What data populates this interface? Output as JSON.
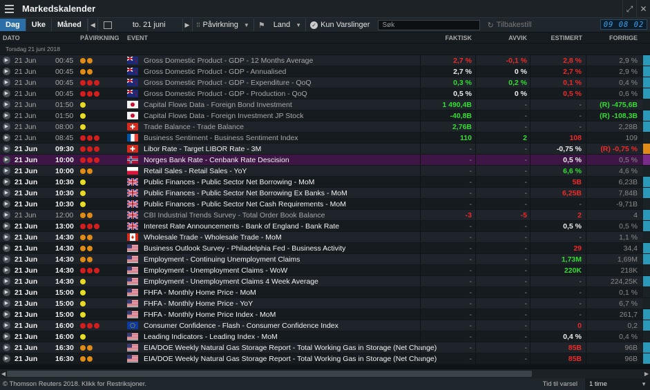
{
  "app": {
    "title": "Markedskalender",
    "clock": "09 08 02"
  },
  "toolbar": {
    "tabs": [
      "Dag",
      "Uke",
      "Måned"
    ],
    "date": "to. 21 juni",
    "impact_filter": "Påvirkning",
    "country_filter": "Land",
    "alerts_only": "Kun Varslinger",
    "search_placeholder": "Søk",
    "reset": "Tilbakestill"
  },
  "columns": {
    "date": "DATO",
    "impact": "PÅVIRKNING",
    "event": "EVENT",
    "actual": "FAKTISK",
    "deviation": "AVVIK",
    "estimate": "ESTIMERT",
    "previous": "FORRIGE"
  },
  "group_label": "Torsdag 21 juni 2018",
  "colors": {
    "accent": "#2c6fa8",
    "highlight": "#3e1646",
    "green": "#33dd33",
    "red": "#ee2a2a"
  },
  "rows": [
    {
      "date": "21 Jun",
      "time": "00:45",
      "impact": "oo",
      "flag": "nz",
      "event": "Gross Domestic Product - GDP - 12 Months Average",
      "actual": "2,7 %",
      "actual_c": "red",
      "dev": "-0,1 %",
      "dev_c": "red",
      "est": "2,8 %",
      "est_c": "red",
      "prev": "2,9 %",
      "prev_c": "gray",
      "past": true
    },
    {
      "date": "21 Jun",
      "time": "00:45",
      "impact": "oo",
      "flag": "nz",
      "event": "Gross Domestic Product - GDP - Annualised",
      "actual": "2,7 %",
      "actual_c": "white",
      "dev": "0 %",
      "dev_c": "white",
      "est": "2,7 %",
      "est_c": "red",
      "prev": "2,9 %",
      "prev_c": "gray",
      "past": true
    },
    {
      "date": "21 Jun",
      "time": "00:45",
      "impact": "rrr",
      "flag": "nz",
      "event": "Gross Domestic Product - GDP - Expenditure - QoQ",
      "actual": "0,3 %",
      "actual_c": "green",
      "dev": "0,2 %",
      "dev_c": "green",
      "est": "0,1 %",
      "est_c": "red",
      "prev": "0,4 %",
      "prev_c": "gray",
      "past": true
    },
    {
      "date": "21 Jun",
      "time": "00:45",
      "impact": "rrr",
      "flag": "nz",
      "event": "Gross Domestic Product - GDP - Production - QoQ",
      "actual": "0,5 %",
      "actual_c": "white",
      "dev": "0 %",
      "dev_c": "white",
      "est": "0,5 %",
      "est_c": "red",
      "prev": "0,6 %",
      "prev_c": "gray",
      "past": true
    },
    {
      "date": "21 Jun",
      "time": "01:50",
      "impact": "y",
      "flag": "jp",
      "event": "Capital Flows Data - Foreign Bond Investment",
      "actual": "1 490,4B",
      "actual_c": "green",
      "dev": "-",
      "dev_c": "gray",
      "est": "-",
      "est_c": "gray",
      "prev": "(R) -475,6B",
      "prev_c": "green",
      "past": true
    },
    {
      "date": "21 Jun",
      "time": "01:50",
      "impact": "y",
      "flag": "jp",
      "event": "Capital Flows Data - Foreign Investment JP Stock",
      "actual": "-40,8B",
      "actual_c": "green",
      "dev": "-",
      "dev_c": "gray",
      "est": "-",
      "est_c": "gray",
      "prev": "(R) -108,3B",
      "prev_c": "green",
      "past": true
    },
    {
      "date": "21 Jun",
      "time": "08:00",
      "impact": "y",
      "flag": "ch",
      "event": "Trade Balance - Trade Balance",
      "actual": "2,76B",
      "actual_c": "green",
      "dev": "-",
      "dev_c": "gray",
      "est": "-",
      "est_c": "gray",
      "prev": "2,28B",
      "prev_c": "gray",
      "past": true
    },
    {
      "date": "21 Jun",
      "time": "08:45",
      "impact": "rrr",
      "flag": "fr",
      "event": "Business Sentiment - Business Sentiment Index",
      "actual": "110",
      "actual_c": "green",
      "dev": "2",
      "dev_c": "green",
      "est": "108",
      "est_c": "red",
      "prev": "109",
      "prev_c": "gray",
      "past": true
    },
    {
      "date": "21 Jun",
      "time": "09:30",
      "impact": "rrr",
      "flag": "ch",
      "event": "Libor Rate - Target LIBOR Rate - 3M",
      "actual": "-",
      "actual_c": "gray",
      "dev": "-",
      "dev_c": "gray",
      "est": "-0,75 %",
      "est_c": "white",
      "prev": "(R) -0,75 %",
      "prev_c": "red",
      "past": false
    },
    {
      "date": "21 Jun",
      "time": "10:00",
      "impact": "rrr",
      "flag": "no",
      "event": "Norges Bank Rate - Cenbank Rate Descision",
      "actual": "-",
      "actual_c": "gray",
      "dev": "-",
      "dev_c": "gray",
      "est": "0,5 %",
      "est_c": "white",
      "prev": "0,5 %",
      "prev_c": "gray",
      "past": false,
      "highlight": true
    },
    {
      "date": "21 Jun",
      "time": "10:00",
      "impact": "oo",
      "flag": "pl",
      "event": "Retail Sales - Retail Sales - YoY",
      "actual": "-",
      "actual_c": "gray",
      "dev": "-",
      "dev_c": "gray",
      "est": "6,6 %",
      "est_c": "green",
      "prev": "4,6 %",
      "prev_c": "gray",
      "past": false
    },
    {
      "date": "21 Jun",
      "time": "10:30",
      "impact": "y",
      "flag": "gb",
      "event": "Public Finances - Public Sector Net Borrowing - MoM",
      "actual": "-",
      "actual_c": "gray",
      "dev": "-",
      "dev_c": "gray",
      "est": "5B",
      "est_c": "red",
      "prev": "6,23B",
      "prev_c": "gray",
      "past": false
    },
    {
      "date": "21 Jun",
      "time": "10:30",
      "impact": "y",
      "flag": "gb",
      "event": "Public Finances - Public Sector Net Borrowing Ex Banks - MoM",
      "actual": "-",
      "actual_c": "gray",
      "dev": "-",
      "dev_c": "gray",
      "est": "6,25B",
      "est_c": "red",
      "prev": "7,84B",
      "prev_c": "gray",
      "past": false
    },
    {
      "date": "21 Jun",
      "time": "10:30",
      "impact": "y",
      "flag": "gb",
      "event": "Public Finances - Public Sector Net Cash Requirements - MoM",
      "actual": "-",
      "actual_c": "gray",
      "dev": "-",
      "dev_c": "gray",
      "est": "-",
      "est_c": "gray",
      "prev": "-9,71B",
      "prev_c": "gray",
      "past": false
    },
    {
      "date": "21 Jun",
      "time": "12:00",
      "impact": "oo",
      "flag": "gb",
      "event": "CBI Industrial Trends Survey - Total Order Book Balance",
      "actual": "-3",
      "actual_c": "red",
      "dev": "-5",
      "dev_c": "red",
      "est": "2",
      "est_c": "red",
      "prev": "4",
      "prev_c": "gray",
      "past": true
    },
    {
      "date": "21 Jun",
      "time": "13:00",
      "impact": "rrr",
      "flag": "gb",
      "event": "Interest Rate Announcements - Bank of England - Bank Rate",
      "actual": "-",
      "actual_c": "gray",
      "dev": "-",
      "dev_c": "gray",
      "est": "0,5 %",
      "est_c": "white",
      "prev": "0,5 %",
      "prev_c": "gray",
      "past": false
    },
    {
      "date": "21 Jun",
      "time": "14:30",
      "impact": "oo",
      "flag": "ca",
      "event": "Wholesale Trade - Wholesale Trade - MoM",
      "actual": "-",
      "actual_c": "gray",
      "dev": "-",
      "dev_c": "gray",
      "est": "-",
      "est_c": "gray",
      "prev": "1,1 %",
      "prev_c": "gray",
      "past": false
    },
    {
      "date": "21 Jun",
      "time": "14:30",
      "impact": "oo",
      "flag": "us",
      "event": "Business Outlook Survey - Philadelphia Fed - Business Activity",
      "actual": "-",
      "actual_c": "gray",
      "dev": "-",
      "dev_c": "gray",
      "est": "29",
      "est_c": "red",
      "prev": "34,4",
      "prev_c": "gray",
      "past": false
    },
    {
      "date": "21 Jun",
      "time": "14:30",
      "impact": "oo",
      "flag": "us",
      "event": "Employment - Continuing Unemployment Claims",
      "actual": "-",
      "actual_c": "gray",
      "dev": "-",
      "dev_c": "gray",
      "est": "1,73M",
      "est_c": "green",
      "prev": "1,69M",
      "prev_c": "gray",
      "past": false
    },
    {
      "date": "21 Jun",
      "time": "14:30",
      "impact": "rrr",
      "flag": "us",
      "event": "Employment - Unemployment Claims - WoW",
      "actual": "-",
      "actual_c": "gray",
      "dev": "-",
      "dev_c": "gray",
      "est": "220K",
      "est_c": "green",
      "prev": "218K",
      "prev_c": "gray",
      "past": false
    },
    {
      "date": "21 Jun",
      "time": "14:30",
      "impact": "y",
      "flag": "us",
      "event": "Employment - Unemployment Claims 4 Week Average",
      "actual": "-",
      "actual_c": "gray",
      "dev": "-",
      "dev_c": "gray",
      "est": "-",
      "est_c": "gray",
      "prev": "224,25K",
      "prev_c": "gray",
      "past": false
    },
    {
      "date": "21 Jun",
      "time": "15:00",
      "impact": "y",
      "flag": "us",
      "event": "FHFA - Monthly Home Price - MoM",
      "actual": "-",
      "actual_c": "gray",
      "dev": "-",
      "dev_c": "gray",
      "est": "-",
      "est_c": "gray",
      "prev": "0,1 %",
      "prev_c": "gray",
      "past": false
    },
    {
      "date": "21 Jun",
      "time": "15:00",
      "impact": "y",
      "flag": "us",
      "event": "FHFA - Monthly Home Price - YoY",
      "actual": "-",
      "actual_c": "gray",
      "dev": "-",
      "dev_c": "gray",
      "est": "-",
      "est_c": "gray",
      "prev": "6,7 %",
      "prev_c": "gray",
      "past": false
    },
    {
      "date": "21 Jun",
      "time": "15:00",
      "impact": "y",
      "flag": "us",
      "event": "FHFA - Monthly Home Price Index - MoM",
      "actual": "-",
      "actual_c": "gray",
      "dev": "-",
      "dev_c": "gray",
      "est": "-",
      "est_c": "gray",
      "prev": "261,7",
      "prev_c": "gray",
      "past": false
    },
    {
      "date": "21 Jun",
      "time": "16:00",
      "impact": "rrr",
      "flag": "eu",
      "event": "Consumer Confidence - Flash - Consumer Confidence Index",
      "actual": "-",
      "actual_c": "gray",
      "dev": "-",
      "dev_c": "gray",
      "est": "0",
      "est_c": "red",
      "prev": "0,2",
      "prev_c": "gray",
      "past": false
    },
    {
      "date": "21 Jun",
      "time": "16:00",
      "impact": "y",
      "flag": "us",
      "event": "Leading Indicators - Leading Index - MoM",
      "actual": "-",
      "actual_c": "gray",
      "dev": "-",
      "dev_c": "gray",
      "est": "0,4 %",
      "est_c": "white",
      "prev": "0,4 %",
      "prev_c": "gray",
      "past": false
    },
    {
      "date": "21 Jun",
      "time": "16:30",
      "impact": "oo",
      "flag": "us",
      "event": "EIA/DOE Weekly Natural Gas Storage Report - Total Working Gas in Storage (Net Change)",
      "actual": "-",
      "actual_c": "gray",
      "dev": "-",
      "dev_c": "gray",
      "est": "85B",
      "est_c": "red",
      "prev": "96B",
      "prev_c": "gray",
      "past": false
    },
    {
      "date": "21 Jun",
      "time": "16:30",
      "impact": "oo",
      "flag": "us",
      "event": "EIA/DOE Weekly Natural Gas Storage Report - Total Working Gas in Storage (Net Change)",
      "actual": "-",
      "actual_c": "gray",
      "dev": "-",
      "dev_c": "gray",
      "est": "85B",
      "est_c": "red",
      "prev": "96B",
      "prev_c": "gray",
      "past": false
    }
  ],
  "side_colors": [
    "#2a9ab8",
    "#2a9ab8",
    "#2a9ab8",
    "#2a9ab8",
    "#1a2226",
    "#2a9ab8",
    "#2a9ab8",
    "#1a2226",
    "#e08a18",
    "#7a2a88",
    "#1a2226",
    "#2a9ab8",
    "#2a9ab8",
    "#1a2226",
    "#2a9ab8",
    "#2a9ab8",
    "#1a2226",
    "#2a9ab8",
    "#2a9ab8",
    "#1a2226",
    "#2a9ab8",
    "#1a2226",
    "#1a2226",
    "#2a9ab8",
    "#2a9ab8",
    "#1a2226",
    "#2a9ab8",
    "#2a9ab8"
  ],
  "status": {
    "copyright": "© Thomson Reuters 2018. Klikk for Restriksjoner.",
    "alert_label": "Tid til varsel",
    "alert_value": "1 time"
  }
}
